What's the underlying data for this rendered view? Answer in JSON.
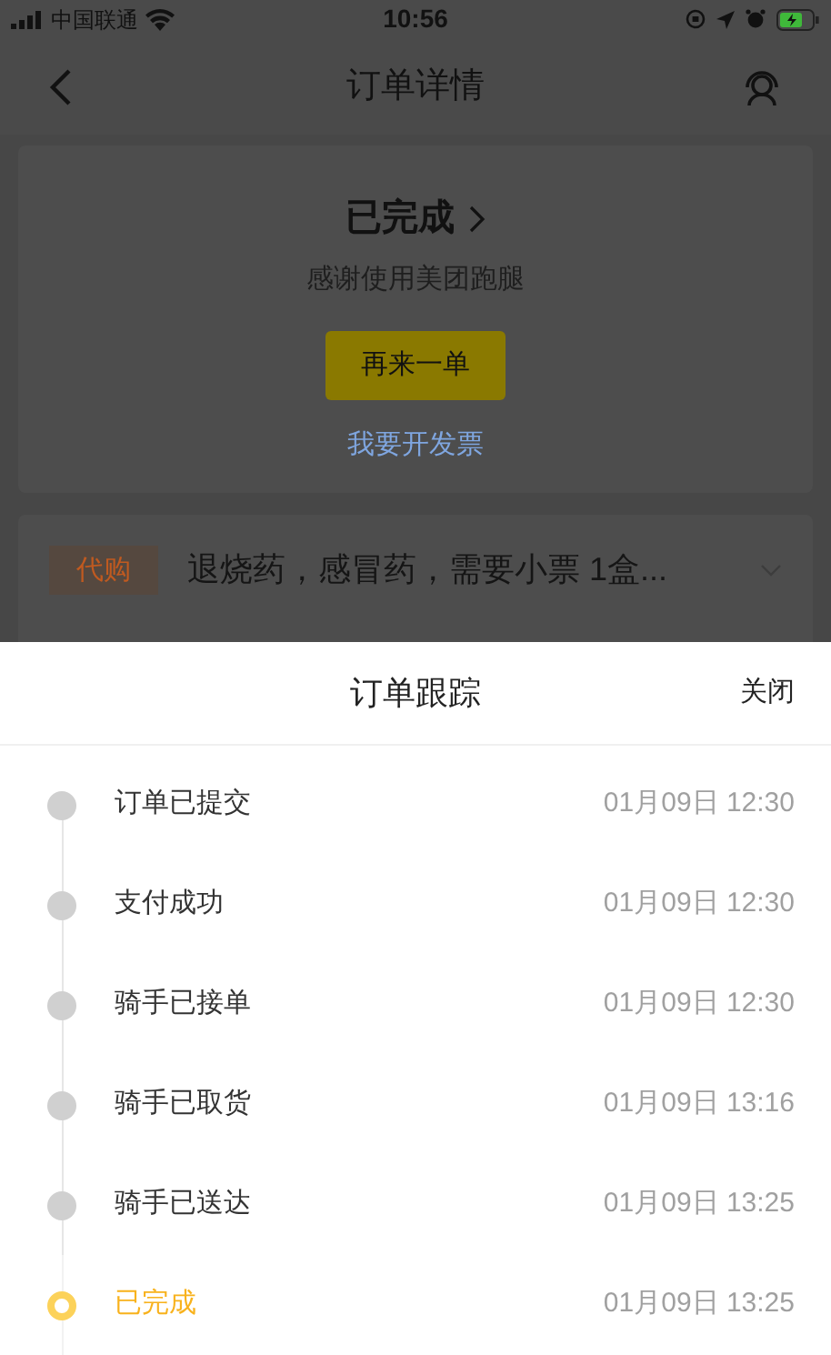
{
  "status_bar": {
    "carrier": "中国联通",
    "time": "10:56"
  },
  "nav": {
    "title": "订单详情"
  },
  "status_card": {
    "status": "已完成",
    "subtitle": "感谢使用美团跑腿",
    "reorder_button": "再来一单",
    "invoice_link": "我要开发票"
  },
  "order_item": {
    "tag": "代购",
    "description": "退烧药，感冒药，需要小票 1盒..."
  },
  "tracking_sheet": {
    "title": "订单跟踪",
    "close": "关闭",
    "steps": [
      {
        "label": "订单已提交",
        "time": "01月09日 12:30",
        "selected": false
      },
      {
        "label": "支付成功",
        "time": "01月09日 12:30",
        "selected": false
      },
      {
        "label": "骑手已接单",
        "time": "01月09日 12:30",
        "selected": false
      },
      {
        "label": "骑手已取货",
        "time": "01月09日 13:16",
        "selected": false
      },
      {
        "label": "骑手已送达",
        "time": "01月09日 13:25",
        "selected": false
      },
      {
        "label": "已完成",
        "time": "01月09日 13:25",
        "selected": true
      }
    ]
  }
}
